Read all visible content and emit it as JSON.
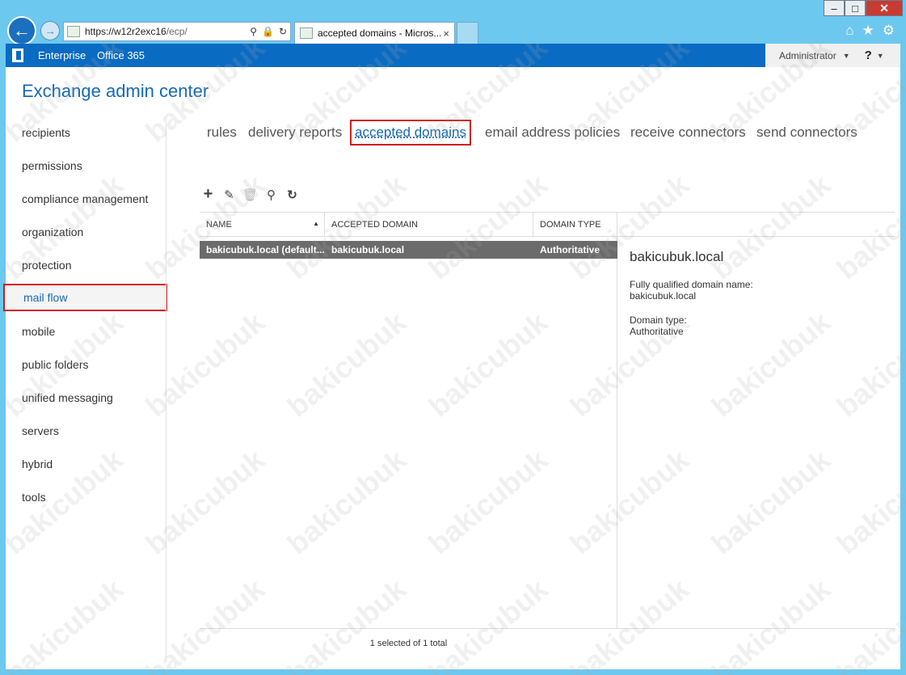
{
  "browser": {
    "address": {
      "host": "https://w12r2exc16",
      "path": "/ecp/"
    },
    "tab_title": "accepted domains - Micros...",
    "tab_close": "×"
  },
  "suitebar": {
    "links": [
      "Enterprise",
      "Office 365"
    ],
    "user": "Administrator",
    "help": "?"
  },
  "app": {
    "title": "Exchange admin center"
  },
  "leftnav": {
    "items": [
      "recipients",
      "permissions",
      "compliance management",
      "organization",
      "protection",
      "mail flow",
      "mobile",
      "public folders",
      "unified messaging",
      "servers",
      "hybrid",
      "tools"
    ],
    "active": "mail flow"
  },
  "tabs": {
    "items": [
      "rules",
      "delivery reports",
      "accepted domains",
      "email address policies",
      "receive connectors",
      "send connectors"
    ],
    "active": "accepted domains"
  },
  "toolbar": {
    "icons": [
      "add-icon",
      "edit-icon",
      "delete-icon",
      "search-icon",
      "refresh-icon"
    ]
  },
  "grid": {
    "columns": [
      "NAME",
      "ACCEPTED DOMAIN",
      "DOMAIN TYPE"
    ],
    "rows": [
      [
        "bakicubuk.local (default...",
        "bakicubuk.local",
        "Authoritative"
      ]
    ],
    "status": "1 selected of 1 total"
  },
  "detail": {
    "title": "bakicubuk.local",
    "fqdn_label": "Fully qualified domain name:",
    "fqdn_value": "bakicubuk.local",
    "type_label": "Domain type:",
    "type_value": "Authoritative"
  },
  "watermark": "bakicubuk"
}
